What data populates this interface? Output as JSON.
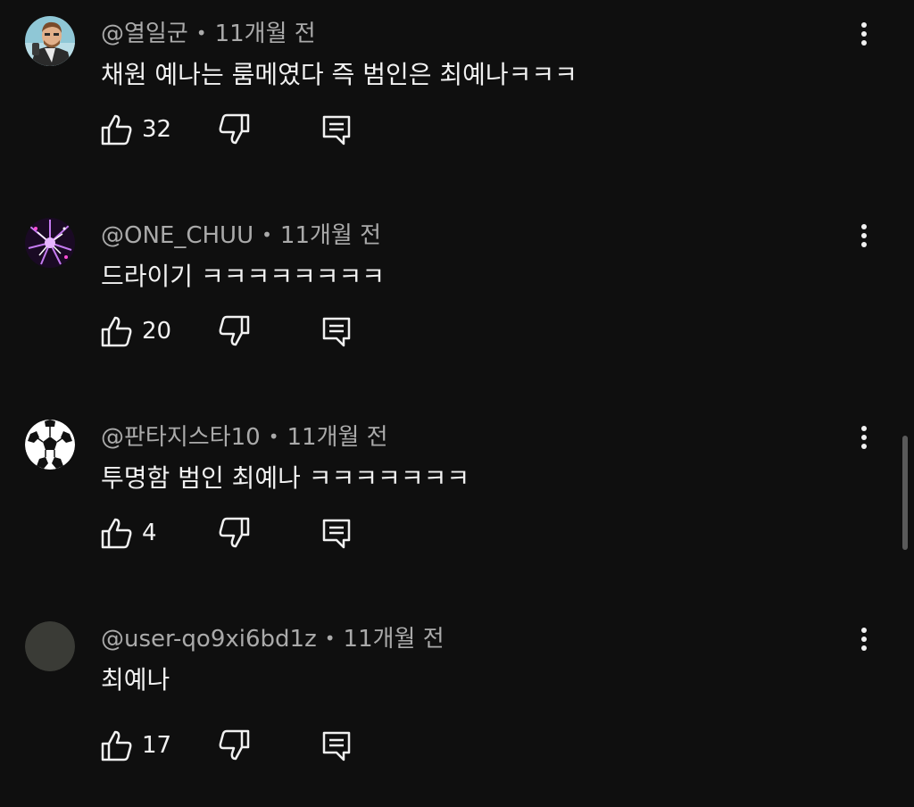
{
  "comments": [
    {
      "author": "@열일군",
      "time": "11개월 전",
      "text": "채원 예나는 룸메였다 즉 범인은 최예나ㅋㅋㅋ",
      "likes": "32",
      "avatar": "cartoon-man-avatar"
    },
    {
      "author": "@ONE_CHUU",
      "time": "11개월 전",
      "text": "드라이기 ㅋㅋㅋㅋㅋㅋㅋㅋ",
      "likes": "20",
      "avatar": "purple-sparkle-avatar"
    },
    {
      "author": "@판타지스타10",
      "time": "11개월 전",
      "text": "투명함 범인 최예나 ㅋㅋㅋㅋㅋㅋㅋ",
      "likes": "4",
      "avatar": "soccer-ball-avatar"
    },
    {
      "author": "@user-qo9xi6bd1z",
      "time": "11개월 전",
      "text": "최예나",
      "likes": "17",
      "avatar": "default-avatar"
    }
  ],
  "colors": {
    "background": "#0f0f0f",
    "text_primary": "#f1f1f1",
    "text_secondary": "#aaaaaa",
    "scrollbar": "#5a5a5a"
  }
}
